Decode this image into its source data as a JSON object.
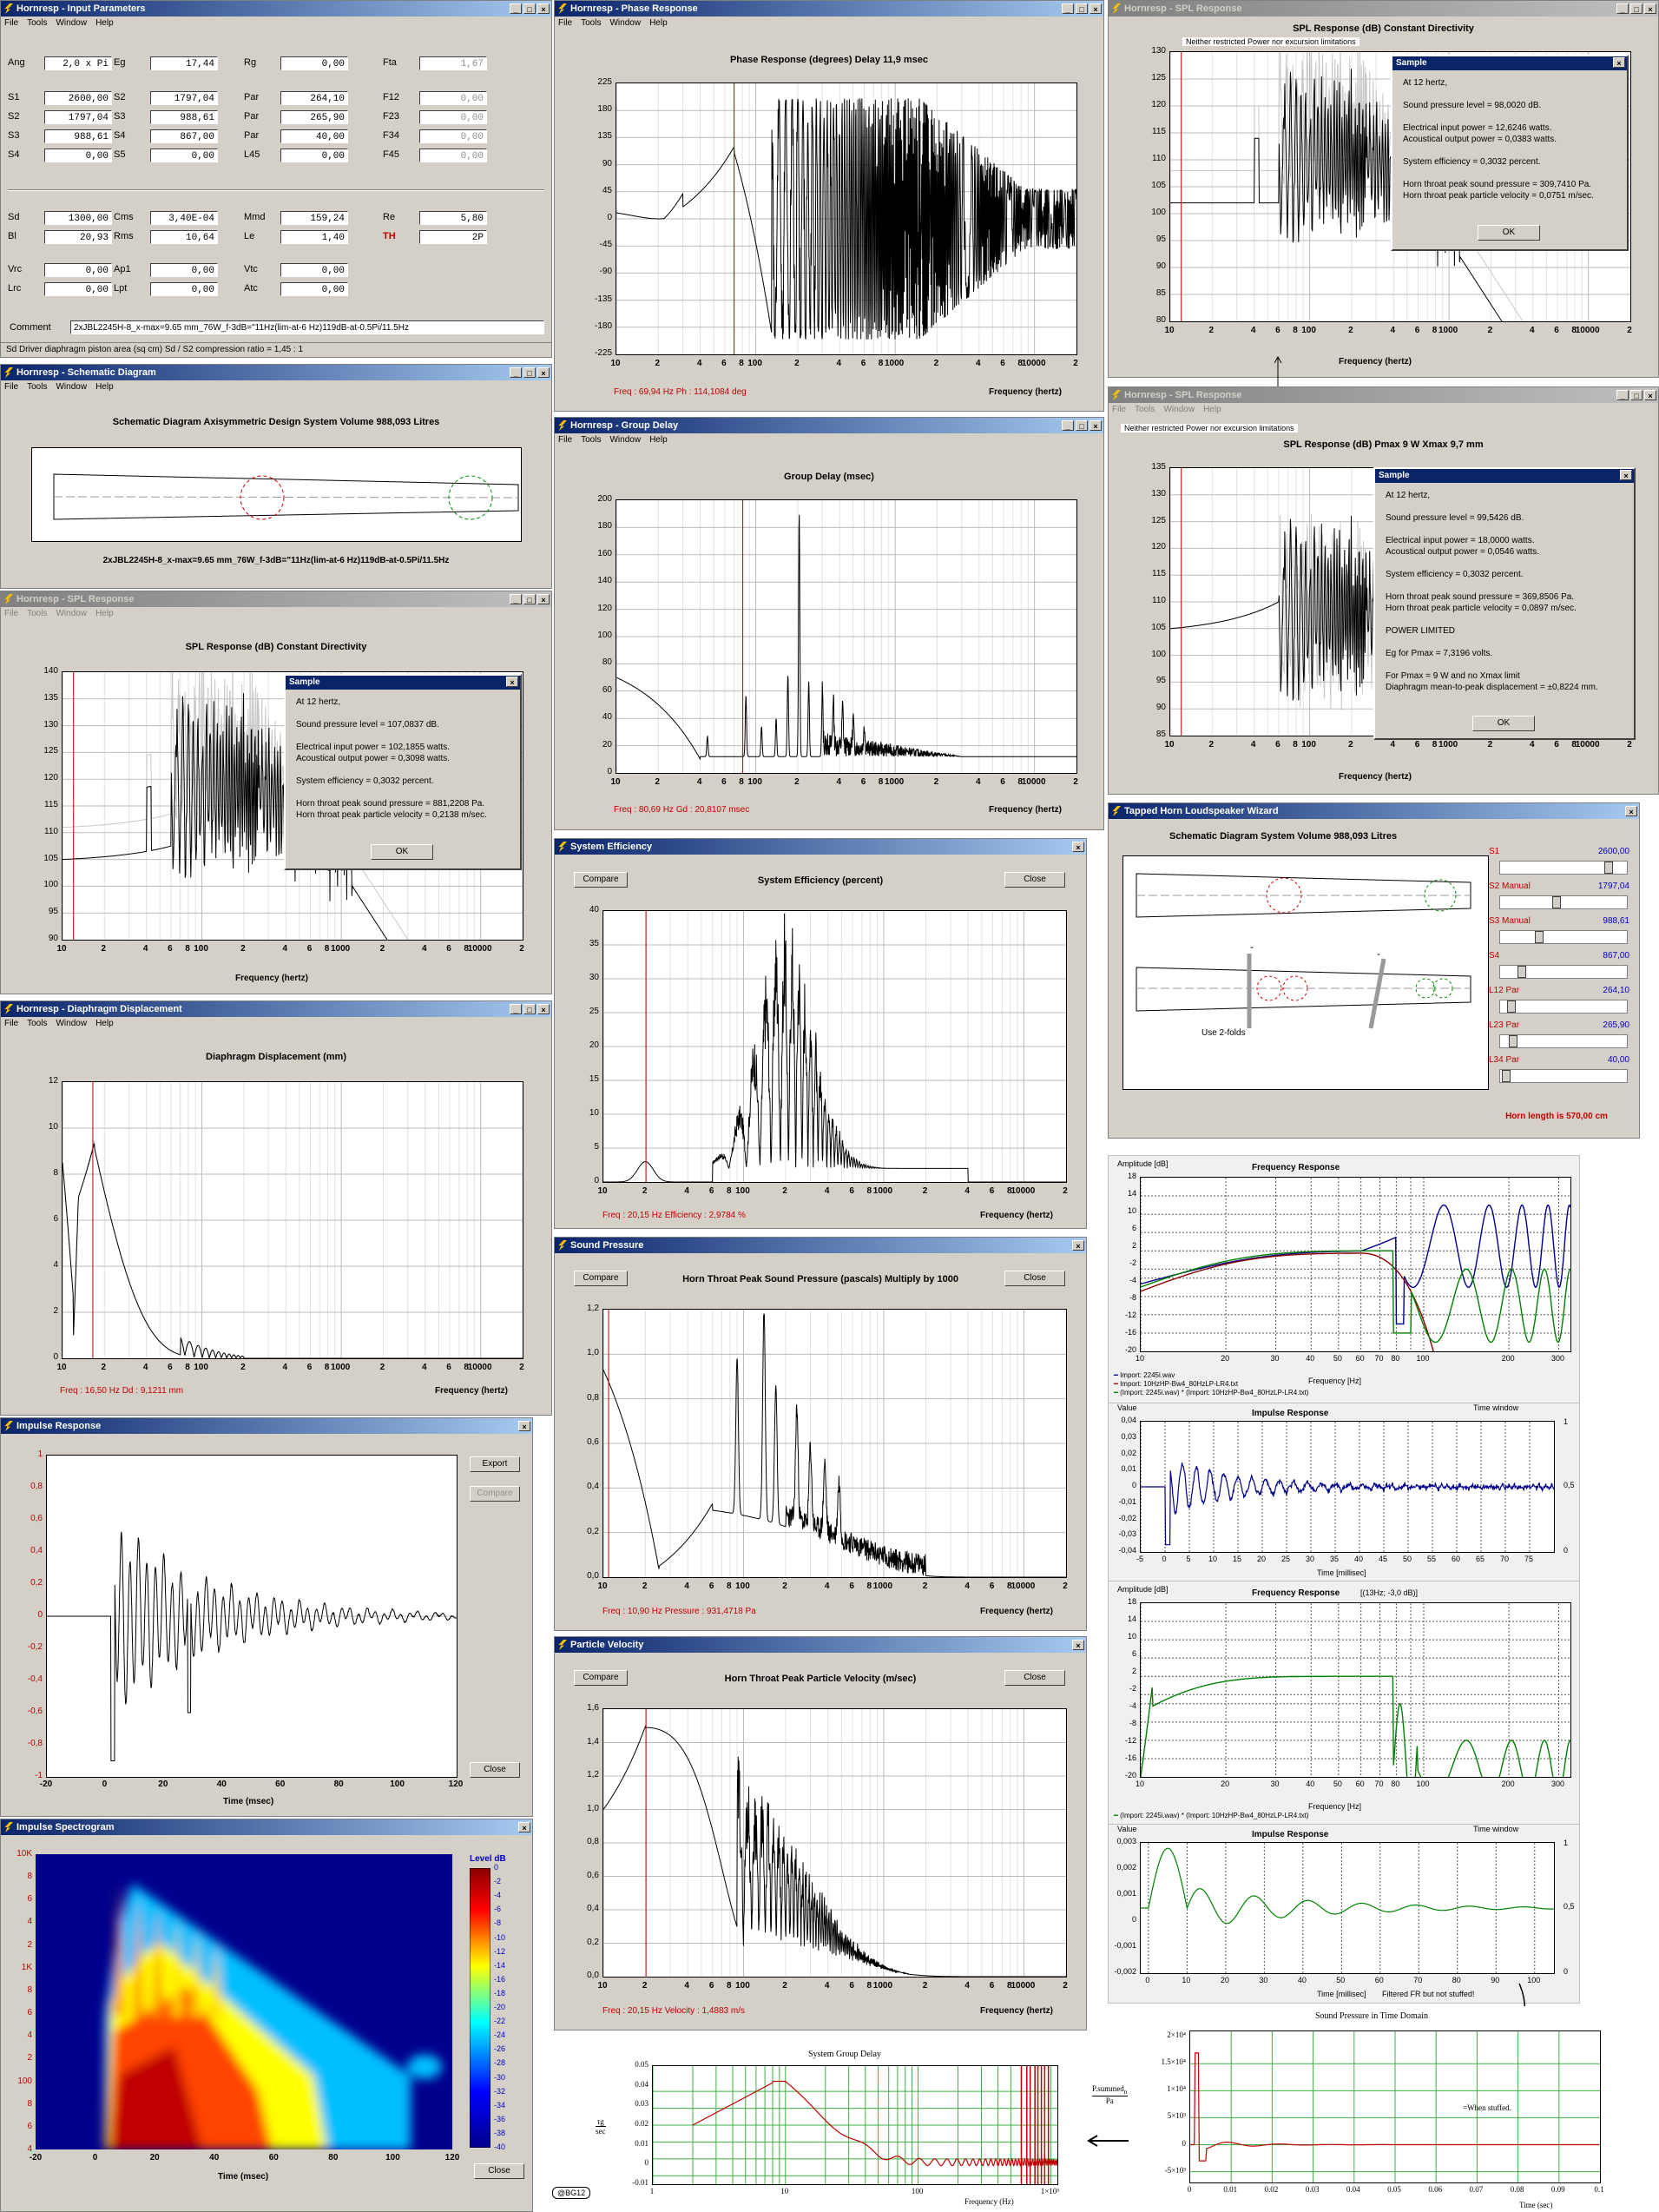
{
  "input_params": {
    "title": "Hornresp - Input Parameters",
    "menu": [
      "File",
      "Tools",
      "Window",
      "Help"
    ],
    "rows": [
      [
        [
          "Ang",
          "2,0 x Pi"
        ],
        [
          "Eg",
          "17,44"
        ],
        [
          "Rg",
          "0,00"
        ],
        [
          "Fta",
          "1,67"
        ]
      ],
      [
        [
          "S1",
          "2600,00"
        ],
        [
          "S2",
          "1797,04"
        ],
        [
          "Par",
          "264,10"
        ],
        [
          "F12",
          "0,00"
        ]
      ],
      [
        [
          "S2",
          "1797,04"
        ],
        [
          "S3",
          "988,61"
        ],
        [
          "Par",
          "265,90"
        ],
        [
          "F23",
          "0,00"
        ]
      ],
      [
        [
          "S3",
          "988,61"
        ],
        [
          "S4",
          "867,00"
        ],
        [
          "Par",
          "40,00"
        ],
        [
          "F34",
          "0,00"
        ]
      ],
      [
        [
          "S4",
          "0,00"
        ],
        [
          "S5",
          "0,00"
        ],
        [
          "L45",
          "0,00"
        ],
        [
          "F45",
          "0,00"
        ]
      ],
      [
        [
          "Sd",
          "1300,00"
        ],
        [
          "Cms",
          "3,40E-04"
        ],
        [
          "Mmd",
          "159,24"
        ],
        [
          "Re",
          "5,80"
        ]
      ],
      [
        [
          "Bl",
          "20,93"
        ],
        [
          "Rms",
          "10,64"
        ],
        [
          "Le",
          "1,40"
        ],
        [
          "TH",
          "2P"
        ]
      ],
      [
        [
          "Vrc",
          "0,00"
        ],
        [
          "Ap1",
          "0,00"
        ],
        [
          "Vtc",
          "0,00"
        ]
      ],
      [
        [
          "Lrc",
          "0,00"
        ],
        [
          "Lpt",
          "0,00"
        ],
        [
          "Atc",
          "0,00"
        ]
      ]
    ],
    "comment_label": "Comment",
    "comment": "2xJBL2245H-8_x-max=9.65 mm_76W_f-3dB=\"11Hz(lim-at-6 Hz)119dB-at-0.5Pi/11.5Hz",
    "status": "Sd   Driver diaphragm piston area  (sq cm)   Sd / S2 compression ratio = 1,45 : 1"
  },
  "schematic": {
    "title": "Hornresp - Schematic Diagram",
    "heading": "Schematic Diagram   Axisymmetric Design   System Volume 988,093 Litres",
    "caption": "2xJBL2245H-8_x-max=9.65 mm_76W_f-3dB=\"11Hz(lim-at-6 Hz)119dB-at-0.5Pi/11.5Hz"
  },
  "phase": {
    "title": "Hornresp - Phase Response",
    "heading": "Phase Response (degrees)   Delay 11,9 msec",
    "yticks": [
      "225",
      "180",
      "135",
      "90",
      "45",
      "0",
      "-45",
      "-90",
      "-135",
      "-180",
      "-225"
    ],
    "cursor": "Freq : 69,94 Hz     Ph : 114,1084 deg",
    "xlabel": "Frequency (hertz)"
  },
  "spl1": {
    "title": "Hornresp - SPL Response",
    "heading": "SPL Response (dB)   Constant Directivity",
    "note": "Neither restricted Power nor excursion limitations",
    "yticks": [
      "130",
      "125",
      "120",
      "115",
      "110",
      "105",
      "100",
      "95",
      "90",
      "85",
      "80"
    ],
    "xlabel": "Frequency (hertz)",
    "dialog": {
      "title": "Sample",
      "lines": [
        "At 12 hertz,",
        "",
        "Sound pressure level = 98,0020 dB.",
        "",
        "Electrical input power = 12,6246 watts.",
        "Acoustical output power = 0,0383 watts.",
        "",
        "System efficiency = 0,3032 percent.",
        "",
        "Horn throat peak sound pressure = 309,7410 Pa.",
        "Horn throat peak particle velocity = 0,0751 m/sec."
      ],
      "ok": "OK"
    }
  },
  "spl2": {
    "title": "Hornresp - SPL Response",
    "menu": [
      "File",
      "Tools",
      "Window",
      "Help"
    ],
    "heading": "SPL Response (dB)   Pmax 9 W   Xmax 9,7 mm",
    "note": "Neither restricted Power nor excursion limitations",
    "yticks": [
      "135",
      "130",
      "125",
      "120",
      "115",
      "110",
      "105",
      "100",
      "95",
      "90",
      "85"
    ],
    "xlabel": "Frequency (hertz)",
    "dialog": {
      "title": "Sample",
      "lines": [
        "At 12 hertz,",
        "",
        "Sound pressure level = 99,5426 dB.",
        "",
        "Electrical input power = 18,0000 watts.",
        "Acoustical output power = 0,0546 watts.",
        "",
        "System efficiency = 0,3032 percent.",
        "",
        "Horn throat peak sound pressure = 369,8506 Pa.",
        "Horn throat peak particle velocity = 0,0897 m/sec.",
        "",
        "POWER LIMITED",
        "",
        "Eg for Pmax = 7,3196 volts.",
        "",
        "For Pmax = 9 W and no Xmax limit",
        "Diaphragm mean-to-peak displacement = ±0,8224 mm."
      ],
      "ok": "OK"
    }
  },
  "spl3": {
    "title": "Hornresp - SPL Response",
    "heading": "SPL Response (dB)   Constant Directivity",
    "yticks": [
      "140",
      "135",
      "130",
      "125",
      "120",
      "115",
      "110",
      "105",
      "100",
      "95",
      "90"
    ],
    "xlabel": "Frequency (hertz)",
    "dialog": {
      "title": "Sample",
      "lines": [
        "At 12 hertz,",
        "",
        "Sound pressure level = 107,0837 dB.",
        "",
        "Electrical input power = 102,1855 watts.",
        "Acoustical output power = 0,3098 watts.",
        "",
        "System efficiency = 0,3032 percent.",
        "",
        "Horn throat peak sound pressure = 881,2208 Pa.",
        "Horn throat peak particle velocity = 0,2138 m/sec."
      ],
      "ok": "OK"
    }
  },
  "group": {
    "title": "Hornresp - Group Delay",
    "heading": "Group Delay (msec)",
    "yticks": [
      "200",
      "180",
      "160",
      "140",
      "120",
      "100",
      "80",
      "60",
      "40",
      "20",
      "0"
    ],
    "cursor": "Freq : 80,69 Hz     Gd : 20,8107 msec",
    "xlabel": "Frequency (hertz)"
  },
  "wizard": {
    "title": "Tapped Horn Loudspeaker Wizard",
    "heading": "Schematic Diagram   System Volume 988,093 Litres",
    "folds": "Use 2-folds",
    "sliders": [
      [
        "S1",
        "2600,00"
      ],
      [
        "S2  Manual",
        "1797,04"
      ],
      [
        "S3  Manual",
        "988,61"
      ],
      [
        "S4",
        "867,00"
      ],
      [
        "L12  Par",
        "264,10"
      ],
      [
        "L23  Par",
        "265,90"
      ],
      [
        "L34  Par",
        "40,00"
      ]
    ],
    "length": "Horn length is 570,00 cm"
  },
  "efficiency": {
    "title": "System Efficiency",
    "compare": "Compare",
    "close": "Close",
    "heading": "System Efficiency (percent)",
    "yticks": [
      "40",
      "35",
      "30",
      "25",
      "20",
      "15",
      "10",
      "5",
      "0"
    ],
    "cursor": "Freq : 20,15 Hz     Efficiency : 2,9784 %",
    "xlabel": "Frequency (hertz)"
  },
  "diaph": {
    "title": "Hornresp - Diaphragm Displacement",
    "heading": "Diaphragm Displacement (mm)",
    "yticks": [
      "12",
      "10",
      "8",
      "6",
      "4",
      "2",
      "0"
    ],
    "cursor": "Freq : 16,50 Hz     Dd : 9,1211 mm",
    "xlabel": "Frequency (hertz)"
  },
  "pressure": {
    "title": "Sound Pressure",
    "compare": "Compare",
    "close": "Close",
    "heading": "Horn Throat Peak Sound Pressure (pascals)   Multiply by 1000",
    "yticks": [
      "1,2",
      "1,0",
      "0,8",
      "0,6",
      "0,4",
      "0,2",
      "0,0"
    ],
    "cursor": "Freq : 10,90 Hz     Pressure : 931,4718 Pa",
    "xlabel": "Frequency (hertz)"
  },
  "impulse": {
    "title": "Impulse Response",
    "export": "Export",
    "compare": "Compare",
    "close": "Close",
    "yticks": [
      "1",
      "0,8",
      "0,6",
      "0,4",
      "0,2",
      "0",
      "-0,2",
      "-0,4",
      "-0,6",
      "-0,8",
      "-1"
    ],
    "xticks": [
      "-20",
      "0",
      "20",
      "40",
      "60",
      "80",
      "100",
      "120"
    ],
    "xlabel": "Time (msec)"
  },
  "velocity": {
    "title": "Particle Velocity",
    "compare": "Compare",
    "close": "Close",
    "heading": "Horn Throat Peak Particle Velocity (m/sec)",
    "yticks": [
      "1,6",
      "1,4",
      "1,2",
      "1,0",
      "0,8",
      "0,6",
      "0,4",
      "0,2",
      "0,0"
    ],
    "cursor": "Freq : 20,15 Hz     Velocity : 1,4883 m/s",
    "xlabel": "Frequency (hertz)"
  },
  "spectro": {
    "title": "Impulse Spectrogram",
    "level": "Level  dB",
    "close": "Close",
    "yticks": [
      "10K",
      "8",
      "6",
      "4",
      "2",
      "1K",
      "8",
      "6",
      "4",
      "2",
      "100",
      "8",
      "6",
      "4"
    ],
    "levels": [
      "0",
      "-2",
      "-4",
      "-6",
      "-8",
      "-10",
      "-12",
      "-14",
      "-16",
      "-18",
      "-20",
      "-22",
      "-24",
      "-26",
      "-28",
      "-30",
      "-32",
      "-34",
      "-36",
      "-38",
      "-40"
    ],
    "xticks": [
      "-20",
      "0",
      "20",
      "40",
      "60",
      "80",
      "100",
      "120"
    ],
    "xlabel": "Time (msec)"
  },
  "fr1": {
    "amp": "Amplitude [dB]",
    "heading": "Frequency Response",
    "yticks": [
      "18",
      "14",
      "10",
      "6",
      "2",
      "-2",
      "-4",
      "-8",
      "-12",
      "-16",
      "-20"
    ],
    "xticks": [
      "10",
      "20",
      "30",
      "40",
      "50",
      "60",
      "70",
      "80",
      "100",
      "200",
      "300"
    ],
    "xlabel": "Frequency [Hz]",
    "legend": [
      "Import: 2245i.wav",
      "Import: 10HzHP-Bw4_80HzLP-LR4.txt",
      "(Import: 2245i.wav) * (Import: 10HzHP-Bw4_80HzLP-LR4.txt)"
    ]
  },
  "imp1": {
    "value": "Value",
    "heading": "Impulse Response",
    "window": "Time window",
    "yticks": [
      "0,04",
      "0,03",
      "0,02",
      "0,01",
      "0",
      "-0,01",
      "-0,02",
      "-0,03",
      "-0,04"
    ],
    "xticks": [
      "-5",
      "0",
      "5",
      "10",
      "15",
      "20",
      "25",
      "30",
      "35",
      "40",
      "45",
      "50",
      "55",
      "60",
      "65",
      "70",
      "75"
    ],
    "rticks": [
      "1",
      "0,5",
      "0"
    ],
    "xlabel": "Time [millisec]"
  },
  "fr2": {
    "amp": "Amplitude [dB]",
    "heading": "Frequency Response",
    "extra": "[(13Hz; -3,0 dB)]",
    "yticks": [
      "18",
      "14",
      "10",
      "6",
      "2",
      "-2",
      "-4",
      "-8",
      "-12",
      "-16",
      "-20"
    ],
    "xticks": [
      "10",
      "20",
      "30",
      "40",
      "50",
      "60",
      "70",
      "80",
      "100",
      "200",
      "300"
    ],
    "xlabel": "Frequency [Hz]",
    "legend": "(Import:  2245i.wav) * (Import:  10HzHP-Bw4_80HzLP-LR4.txt)"
  },
  "imp2": {
    "value": "Value",
    "heading": "Impulse Response",
    "window": "Time window",
    "yticks": [
      "0,003",
      "0,002",
      "0,001",
      "0",
      "-0,001",
      "-0,002"
    ],
    "xticks": [
      "0",
      "10",
      "20",
      "30",
      "40",
      "50",
      "60",
      "70",
      "80",
      "90",
      "100"
    ],
    "rticks": [
      "1",
      "0,5",
      "0"
    ],
    "xlabel": "Time [millisec]",
    "note": "Filtered FR but not stuffed!"
  },
  "sgd": {
    "heading": "System Group Delay",
    "yticks": [
      "0.05",
      "0.04",
      "0.03",
      "0.02",
      "0.01",
      "0",
      "-0.01"
    ],
    "xticks": [
      "1",
      "10",
      "100",
      "1×10³"
    ],
    "xlabel": "Frequency (Hz)",
    "unit_top": "τg",
    "unit_bot": "sec"
  },
  "spt": {
    "heading": "Sound Pressure in Time Domain",
    "yticks": [
      "2×10⁴",
      "1.5×10⁴",
      "1×10⁴",
      "5×10³",
      "0",
      "-5×10³"
    ],
    "xticks": [
      "0",
      "0.01",
      "0.02",
      "0.03",
      "0.04",
      "0.05",
      "0.06",
      "0.07",
      "0.08",
      "0.09",
      "0.1"
    ],
    "xlabel": "Time (sec)",
    "unit_top": "P.summed",
    "unit_sub": "n",
    "unit_bot": "Pa",
    "note": "=When stuffed."
  },
  "copyright": "@BG12",
  "xfreq": [
    "10",
    "2",
    "4",
    "6",
    "8",
    "100",
    "2",
    "4",
    "6",
    "8",
    "1000",
    "2",
    "4",
    "6",
    "8",
    "10000",
    "2"
  ]
}
